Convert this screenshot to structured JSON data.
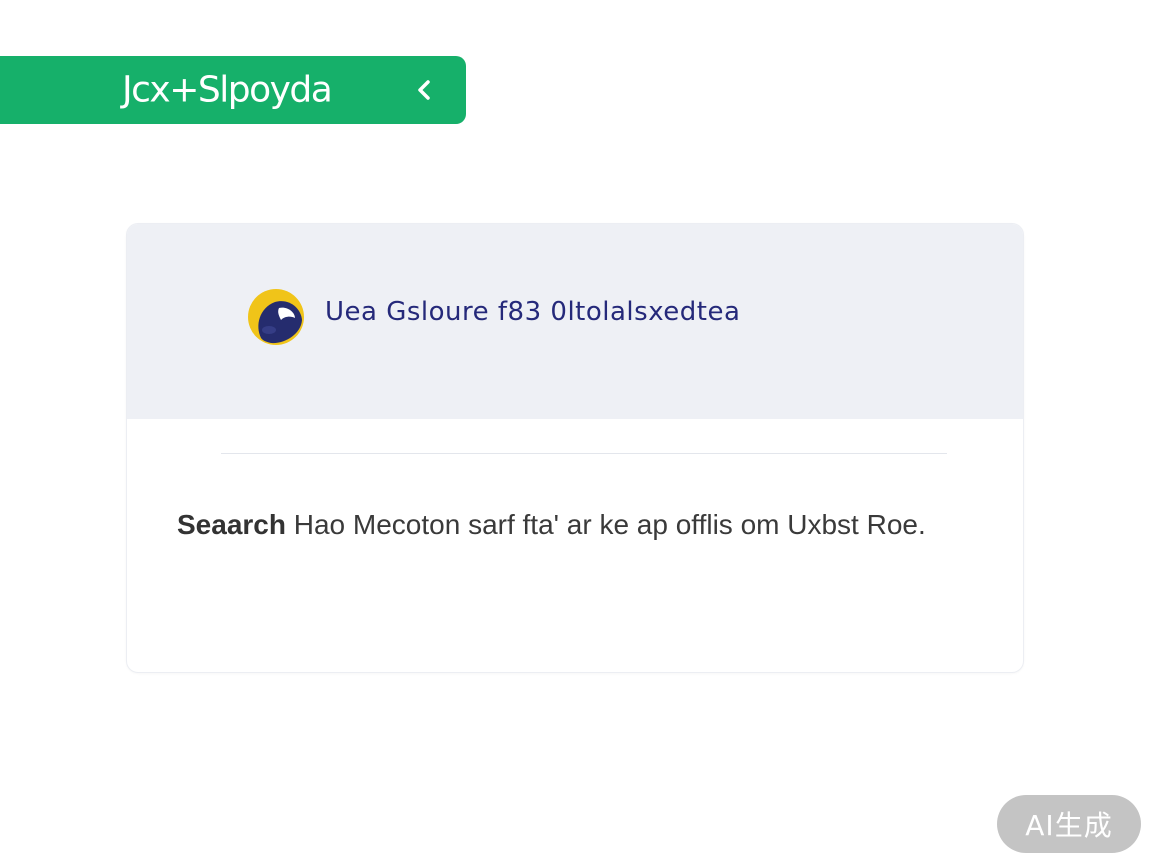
{
  "brand": {
    "name": "Jcx+Slpoyda",
    "collapse_icon": "chevron-left-icon"
  },
  "card": {
    "logo_icon": "globe-logo-icon",
    "title": "Uea Gsloure f83 0ltolalsxedtea",
    "body_bold": "Seaarch",
    "body_rest": " Hao Mecoton sarf fta' ar ke ap offlis om Uxbst Roe."
  },
  "watermark": {
    "label": "AI生成"
  },
  "colors": {
    "brand_green": "#16b06a",
    "card_header_bg": "#eef0f5",
    "title_navy": "#25297a",
    "badge_gray": "#c4c4c4"
  }
}
